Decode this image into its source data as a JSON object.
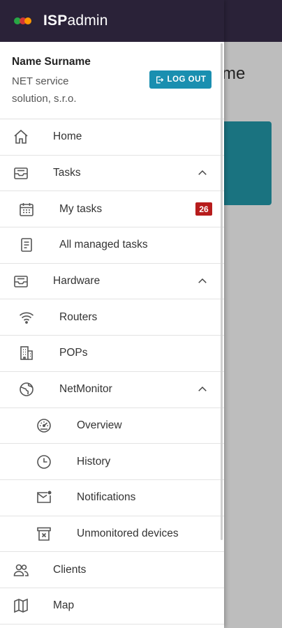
{
  "app": {
    "brand_bold": "ISP",
    "brand_light": "admin",
    "background_title": "me"
  },
  "user": {
    "name": "Name Surname",
    "company": "NET service solution, s.r.o.",
    "logout_label": "LOG OUT"
  },
  "badge": {
    "my_tasks_count": "26"
  },
  "menu": {
    "home": "Home",
    "tasks": "Tasks",
    "my_tasks": "My tasks",
    "all_managed_tasks": "All managed tasks",
    "hardware": "Hardware",
    "routers": "Routers",
    "pops": "POPs",
    "netmonitor": "NetMonitor",
    "overview": "Overview",
    "history": "History",
    "notifications": "Notifications",
    "unmonitored_devices": "Unmonitored devices",
    "clients": "Clients",
    "map": "Map"
  },
  "colors": {
    "header_bg": "#2a2238",
    "accent": "#1a8fb0",
    "badge": "#b71c1c",
    "icon": "#555555"
  }
}
